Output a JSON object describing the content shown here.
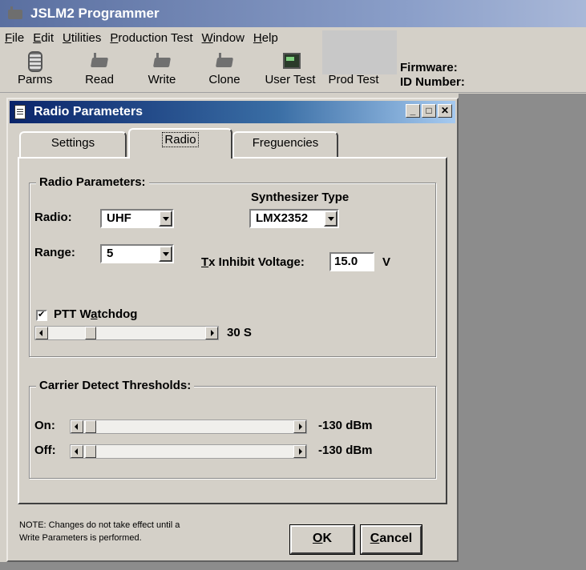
{
  "app": {
    "title": "JSLM2 Programmer"
  },
  "menu": [
    {
      "label": "File",
      "ul": "F",
      "rest": "ile"
    },
    {
      "label": "Edit",
      "ul": "E",
      "rest": "dit"
    },
    {
      "label": "Utilities",
      "ul": "U",
      "rest": "tilities"
    },
    {
      "label": "Production Test",
      "ul": "P",
      "rest": "roduction Test"
    },
    {
      "label": "Window",
      "ul": "W",
      "rest": "indow"
    },
    {
      "label": "Help",
      "ul": "H",
      "rest": "elp"
    }
  ],
  "toolbar": {
    "parms": {
      "label": "Parms",
      "icon": "parms-icon"
    },
    "read": {
      "label": "Read",
      "icon": "radio-read-icon"
    },
    "write": {
      "label": "Write",
      "icon": "radio-write-icon"
    },
    "clone": {
      "label": "Clone",
      "icon": "radio-clone-icon"
    },
    "user_test": {
      "label": "User Test",
      "icon": "user-test-icon"
    },
    "prod_test": {
      "label": "Prod Test"
    },
    "firmware_label": "Firmware:",
    "id_label": "ID Number:"
  },
  "dialog": {
    "title": "Radio Parameters",
    "tabs": {
      "settings": "Settings",
      "radio": "Radio",
      "frequencies": "Freguencies"
    },
    "radio_group": {
      "label": "Radio Parameters:",
      "radio_label": "Radio:",
      "radio_value": "UHF",
      "range_label": "Range:",
      "range_value": "5",
      "synth_label": "Synthesizer Type",
      "synth_value": "LMX2352",
      "tx_label_ul": "T",
      "tx_label_rest": "x Inhibit Voltage:",
      "tx_value": "15.0",
      "tx_unit": "V",
      "ptt_label_a": "PTT W",
      "ptt_label_ul": "a",
      "ptt_label_b": "tchdog",
      "ptt_checked": true,
      "ptt_value": "30 S"
    },
    "carrier_group": {
      "label": "Carrier Detect Thresholds:",
      "on_label": "On:",
      "on_value": "-130 dBm",
      "off_label": "Off:",
      "off_value": "-130 dBm"
    },
    "note_line1": "NOTE:  Changes do not take effect until a",
    "note_line2": "Write Parameters is performed.",
    "ok_ul": "O",
    "ok_rest": "K",
    "cancel_ul": "C",
    "cancel_rest": "ancel"
  },
  "colors": {
    "face": "#d4d0c8",
    "title_active": "#0a246a",
    "desktop": "#8c8c8c"
  }
}
